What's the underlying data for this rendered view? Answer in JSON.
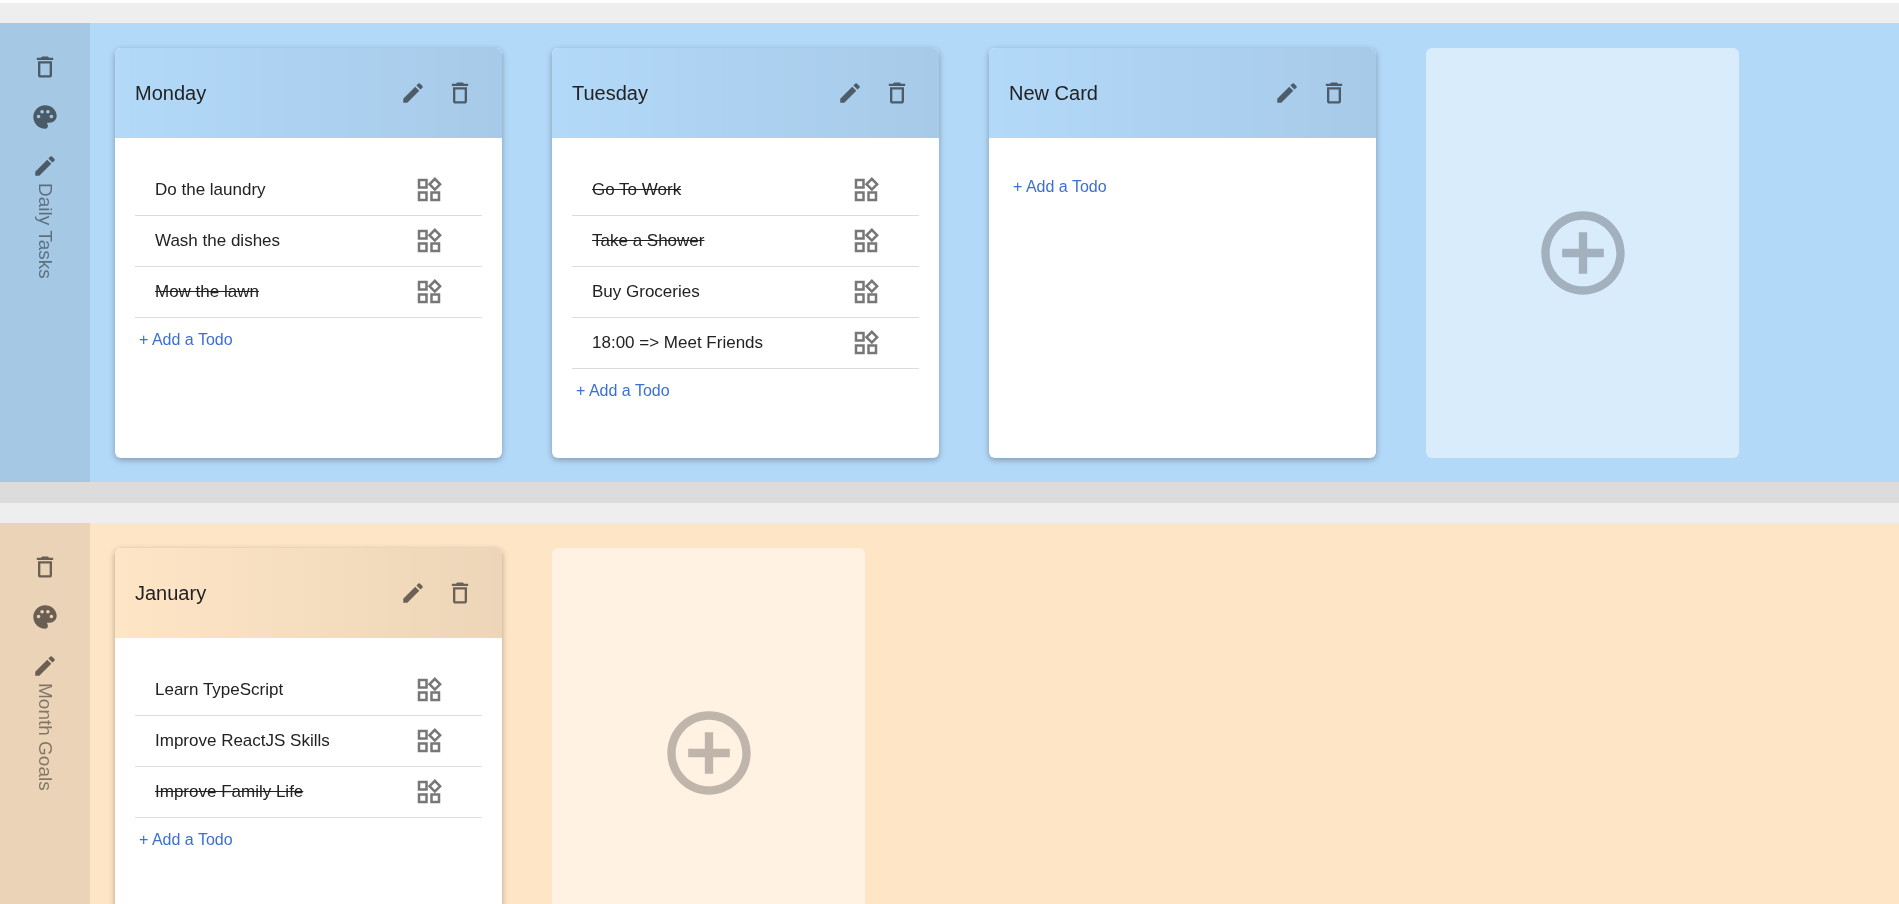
{
  "boards": [
    {
      "title": "Daily Tasks",
      "color": "#b3d9f9",
      "cards": [
        {
          "title": "Monday",
          "todos": [
            {
              "text": "Do the laundry",
              "done": false
            },
            {
              "text": "Wash the dishes",
              "done": false
            },
            {
              "text": "Mow the lawn",
              "done": true
            }
          ],
          "add_label": "+ Add a Todo"
        },
        {
          "title": "Tuesday",
          "todos": [
            {
              "text": "Go To Work",
              "done": true
            },
            {
              "text": "Take a Shower",
              "done": true
            },
            {
              "text": "Buy Groceries",
              "done": false
            },
            {
              "text": "18:00 => Meet Friends",
              "done": false
            }
          ],
          "add_label": "+ Add a Todo"
        },
        {
          "title": "New Card",
          "add_label": "+ Add a Todo"
        }
      ]
    },
    {
      "title": "Month Goals",
      "color": "#fee5c6",
      "cards": [
        {
          "title": "January",
          "todos": [
            {
              "text": "Learn TypeScript",
              "done": false
            },
            {
              "text": "Improve ReactJS Skills",
              "done": false
            },
            {
              "text": "Improve Family Life",
              "done": true
            }
          ],
          "add_label": "+ Add a Todo"
        }
      ]
    }
  ]
}
